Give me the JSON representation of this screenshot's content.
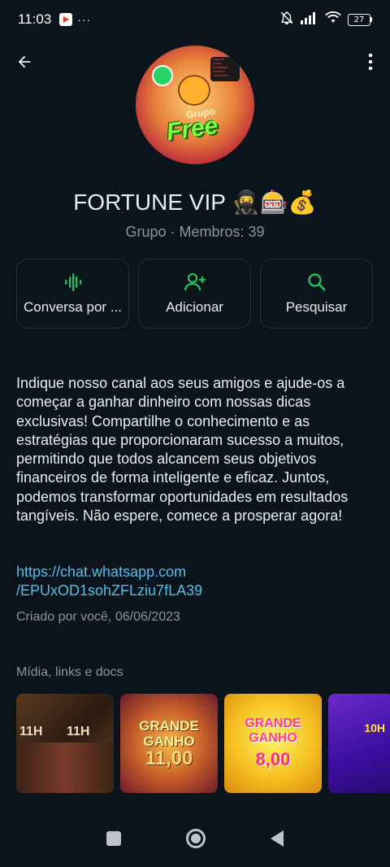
{
  "status_bar": {
    "time": "11:03",
    "overflow": "···",
    "battery": "27",
    "icons": [
      "play-store-icon",
      "muted-bell-icon",
      "signal-icon",
      "wifi-icon",
      "battery-icon"
    ]
  },
  "header": {
    "back_icon": "arrow-left-icon",
    "menu_icon": "more-vert-icon"
  },
  "avatar": {
    "grupo": "Grupo",
    "free": "Free",
    "tag_lines": [
      "Suporte",
      "Dicas",
      "Estratégia",
      "Sorteios",
      "Novidades"
    ]
  },
  "group": {
    "title": "FORTUNE VIP 🥷🎰💰",
    "subtitle": "Grupo · Membros: 39"
  },
  "actions": [
    {
      "label": "Conversa por ...",
      "icon": "audio-wave-icon"
    },
    {
      "label": "Adicionar",
      "icon": "add-person-icon"
    },
    {
      "label": "Pesquisar",
      "icon": "search-icon"
    }
  ],
  "description": "Indique nosso canal aos seus amigos e ajude-os a começar a ganhar dinheiro com nossas dicas exclusivas! Compartilhe o conhecimento e as estratégias que proporcionaram sucesso a muitos, permitindo que todos alcancem seus objetivos financeiros de forma inteligente e eficaz. Juntos, podemos transformar oportunidades em resultados tangíveis. Não espere, comece a prosperar agora!",
  "link": {
    "line1": "https://chat.whatsapp.com",
    "line2": "/EPUxOD1sohZFLziu7fLA39"
  },
  "created": "Criado por você, 06/06/2023",
  "media": {
    "title": "Mídia, links e docs",
    "thumbs": [
      {
        "labels": [
          "11H",
          "11H"
        ]
      },
      {
        "heading": "GRANDE GANHO",
        "value": "11,00"
      },
      {
        "heading": "GRANDE GANHO",
        "value": "8,00"
      },
      {
        "heading": "10H"
      }
    ]
  },
  "colors": {
    "background": "#0b141a",
    "accent_green": "#00a884",
    "link": "#53bdeb",
    "muted": "#8696a0"
  }
}
